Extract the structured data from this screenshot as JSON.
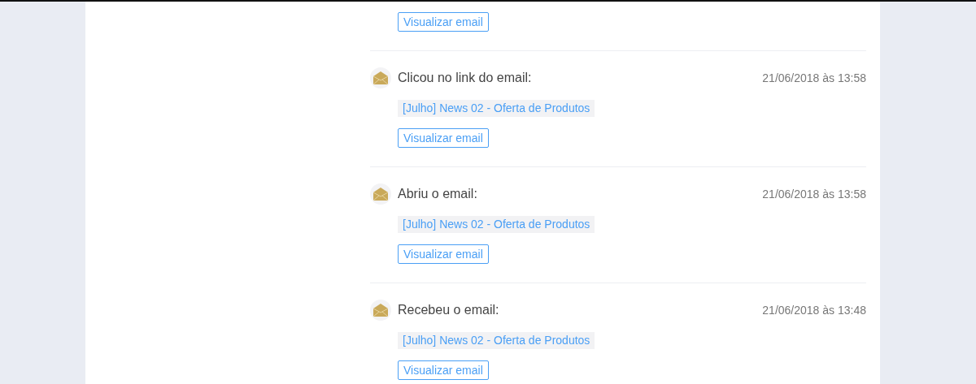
{
  "top_entry": {
    "button": "Visualizar email"
  },
  "events": [
    {
      "title": "Clicou no link do email:",
      "date": "21/06/2018 às 13:58",
      "email": "[Julho] News 02 - Oferta de Produtos",
      "button": "Visualizar email"
    },
    {
      "title": "Abriu o email:",
      "date": "21/06/2018 às 13:58",
      "email": "[Julho] News 02 - Oferta de Produtos",
      "button": "Visualizar email"
    },
    {
      "title": "Recebeu o email:",
      "date": "21/06/2018 às 13:48",
      "email": "[Julho] News 02 - Oferta de Produtos",
      "button": "Visualizar email"
    }
  ]
}
